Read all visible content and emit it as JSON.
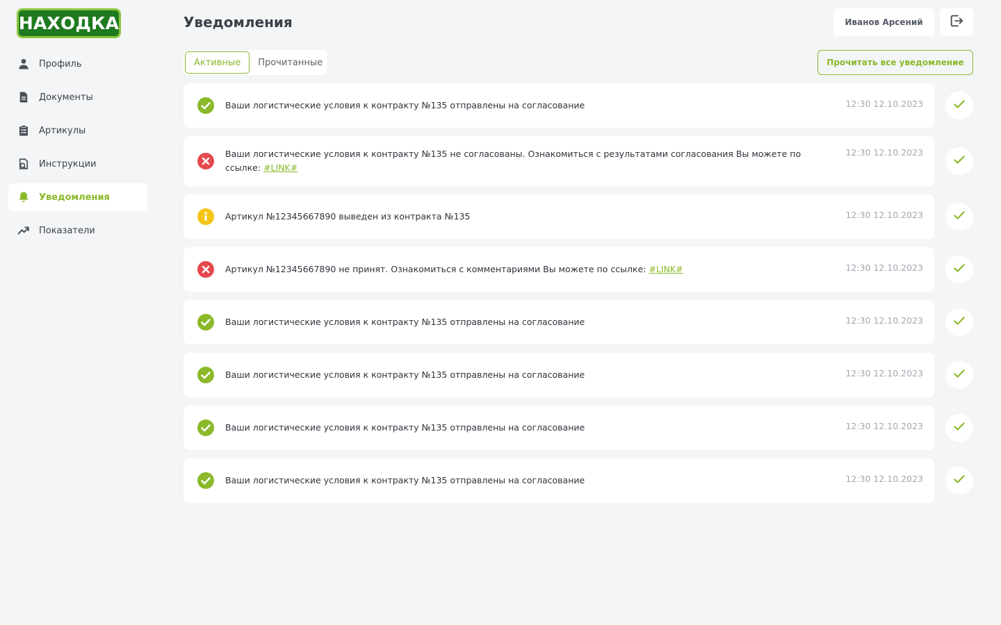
{
  "app": {
    "logo_text": "НАХОДКА",
    "accent": "#8bb92a"
  },
  "sidebar": {
    "items": [
      {
        "label": "Профиль",
        "icon": "user-icon"
      },
      {
        "label": "Документы",
        "icon": "document-icon"
      },
      {
        "label": "Артикулы",
        "icon": "clipboard-icon"
      },
      {
        "label": "Инструкции",
        "icon": "instructions-icon"
      },
      {
        "label": "Уведомления",
        "icon": "bell-icon",
        "active": true
      },
      {
        "label": "Показатели",
        "icon": "trend-icon"
      }
    ]
  },
  "header": {
    "title": "Уведомления",
    "user_name": "Иванов Арсений",
    "logout_icon": "logout-icon"
  },
  "tabs": [
    {
      "label": "Активные",
      "active": true
    },
    {
      "label": "Прочитанные",
      "active": false
    }
  ],
  "read_all_label": "Прочитать все уведомление",
  "notifications": [
    {
      "status": "success",
      "text": "Ваши логистические условия к контракту №135 отправлены на согласование",
      "link": "",
      "time": "12:30 12.10.2023"
    },
    {
      "status": "error",
      "text": "Ваши логистические условия к контракту №135 не согласованы. Ознакомиться с результатами согласования Вы можете по ссылке: ",
      "link": "#LINK#",
      "time": "12:30 12.10.2023"
    },
    {
      "status": "info",
      "text": "Артикул №12345667890 выведен из контракта №135",
      "link": "",
      "time": "12:30 12.10.2023"
    },
    {
      "status": "error",
      "text": "Артикул №12345667890 не принят. Ознакомиться с комментариями Вы можете по ссылке: ",
      "link": "#LINK#",
      "time": "12:30 12.10.2023"
    },
    {
      "status": "success",
      "text": "Ваши логистические условия к контракту №135 отправлены на согласование",
      "link": "",
      "time": "12:30 12.10.2023"
    },
    {
      "status": "success",
      "text": "Ваши логистические условия к контракту №135 отправлены на согласование",
      "link": "",
      "time": "12:30 12.10.2023"
    },
    {
      "status": "success",
      "text": "Ваши логистические условия к контракту №135 отправлены на согласование",
      "link": "",
      "time": "12:30 12.10.2023"
    },
    {
      "status": "success",
      "text": "Ваши логистические условия к контракту №135 отправлены на согласование",
      "link": "",
      "time": "12:30 12.10.2023"
    }
  ],
  "status_colors": {
    "success": "#8bb92a",
    "error": "#e5484d",
    "info": "#f5c518"
  }
}
